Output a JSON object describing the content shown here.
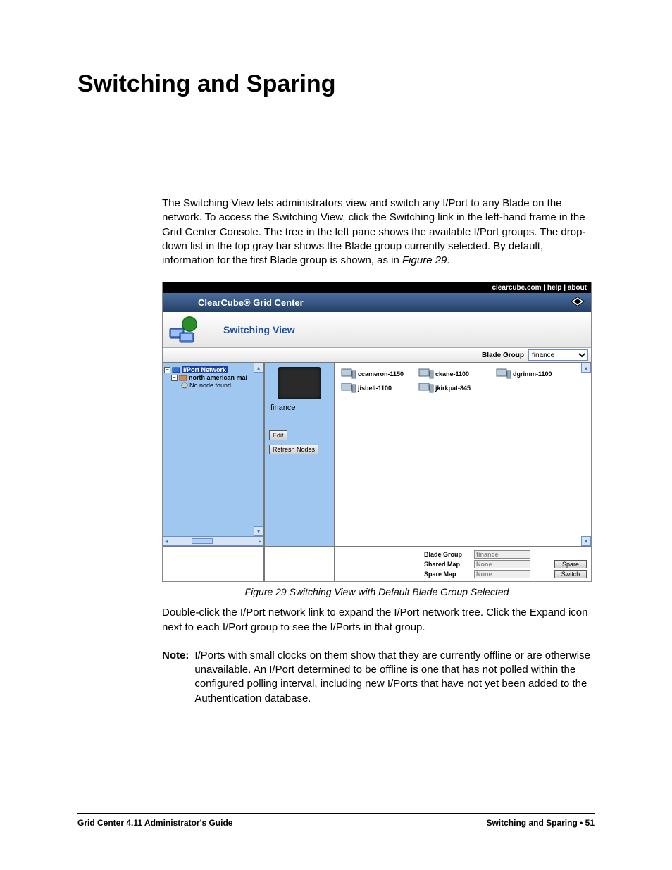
{
  "title": "Switching and Sparing",
  "intro": "The Switching View lets administrators view and switch any I/Port to any Blade on the network. To access the Switching View, click the Switching link in the left-hand frame in the Grid Center Console. The tree in the left pane shows the available I/Port groups. The drop-down list in the top gray bar shows the Blade group currently selected. By default, information for the first Blade group is shown, as in ",
  "intro_figref": "Figure 29",
  "intro_tail": ".",
  "screenshot": {
    "top_links": "clearcube.com  |  help  |  about",
    "brand": "ClearCube® Grid Center",
    "view_title": "Switching View",
    "blade_group_label": "Blade Group",
    "blade_group_value": "finance",
    "tree": {
      "root": "I/Port Network",
      "child1": "north american mai",
      "child2": "No node found"
    },
    "mid": {
      "group_name": "finance",
      "edit_btn": "Edit",
      "refresh_btn": "Refresh Nodes"
    },
    "nodes": [
      "ccameron-1150",
      "ckane-1100",
      "dgrimm-1100",
      "jisbell-1100",
      "jkirkpat-845"
    ],
    "bottom": {
      "bg_label": "Blade Group",
      "bg_value": "finance",
      "shared_label": "Shared Map",
      "shared_value": "None",
      "spare_label": "Spare Map",
      "spare_value": "None",
      "spare_btn": "Spare",
      "switch_btn": "Switch"
    }
  },
  "caption": "Figure 29  Switching View with Default Blade Group Selected",
  "para2": "Double-click the I/Port network link to expand the I/Port network tree. Click the Expand icon next to each I/Port group to see the I/Ports in that group.",
  "note_label": "Note:",
  "note_body": "I/Ports with small clocks on them show that they are currently offline or are otherwise unavailable. An I/Port determined to be offline is one that has not polled within the configured polling interval, including new I/Ports that have not yet been added to the Authentication database.",
  "footer_left": "Grid Center 4.11 Administrator's Guide",
  "footer_right": "Switching and Sparing • 51"
}
